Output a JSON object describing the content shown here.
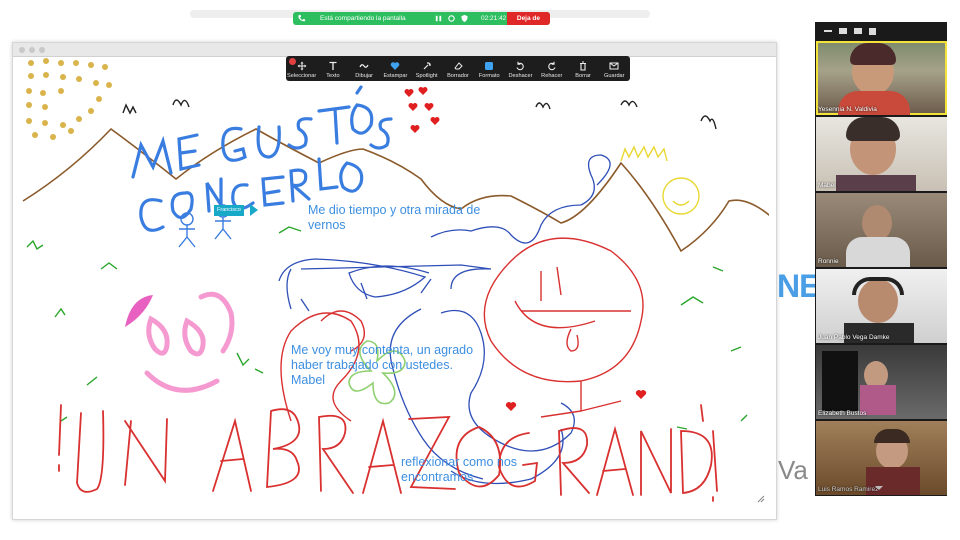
{
  "share_bar": {
    "status": "Está compartiendo la pantalla",
    "time": "02:21:42",
    "stop_label": "Deja de"
  },
  "toolbar": {
    "tools": [
      {
        "label": "Seleccionar",
        "icon": "move-icon"
      },
      {
        "label": "Texto",
        "icon": "text-icon"
      },
      {
        "label": "Dibujar",
        "icon": "draw-icon"
      },
      {
        "label": "Estampar",
        "icon": "stamp-icon"
      },
      {
        "label": "Spotlight",
        "icon": "spotlight-icon"
      },
      {
        "label": "Borrador",
        "icon": "eraser-icon"
      },
      {
        "label": "Formato",
        "icon": "format-icon"
      },
      {
        "label": "Deshacer",
        "icon": "undo-icon"
      },
      {
        "label": "Rehacer",
        "icon": "redo-icon"
      },
      {
        "label": "Borrar",
        "icon": "trash-icon"
      },
      {
        "label": "Guardar",
        "icon": "save-icon"
      }
    ]
  },
  "whiteboard": {
    "tag_label": "Francisco",
    "note1": "Me dio tiempo y otra mirada de\nvernos",
    "note2": "Me voy muy contenta, un agrado\nhaber trabajado con ustedes.\nMabel",
    "note3": "reflexionar como nos\nencontramos",
    "drawn_title": "ME GUSTÓ CONOCERLOS",
    "drawn_bottom": "¡UN ABRAZO GRANDE!"
  },
  "background": {
    "text_ne": "NE",
    "text_va": "Va"
  },
  "colors": {
    "ink_blue": "#3a7de0",
    "ink_red": "#d93030",
    "note_blue": "#3d8fe0",
    "share_green": "#2dbe60",
    "stop_red": "#e02828",
    "active_speaker": "#f3e23a"
  },
  "participants": [
    {
      "name": "Yesennia N. Valdivia",
      "active": true
    },
    {
      "name": "Mabel",
      "active": false
    },
    {
      "name": "Ronnie",
      "active": false
    },
    {
      "name": "Juan Pablo Vega Damke",
      "active": false
    },
    {
      "name": "Elizabeth Bustos",
      "active": false
    },
    {
      "name": "Luis Ramos Ramirez",
      "active": false
    }
  ]
}
